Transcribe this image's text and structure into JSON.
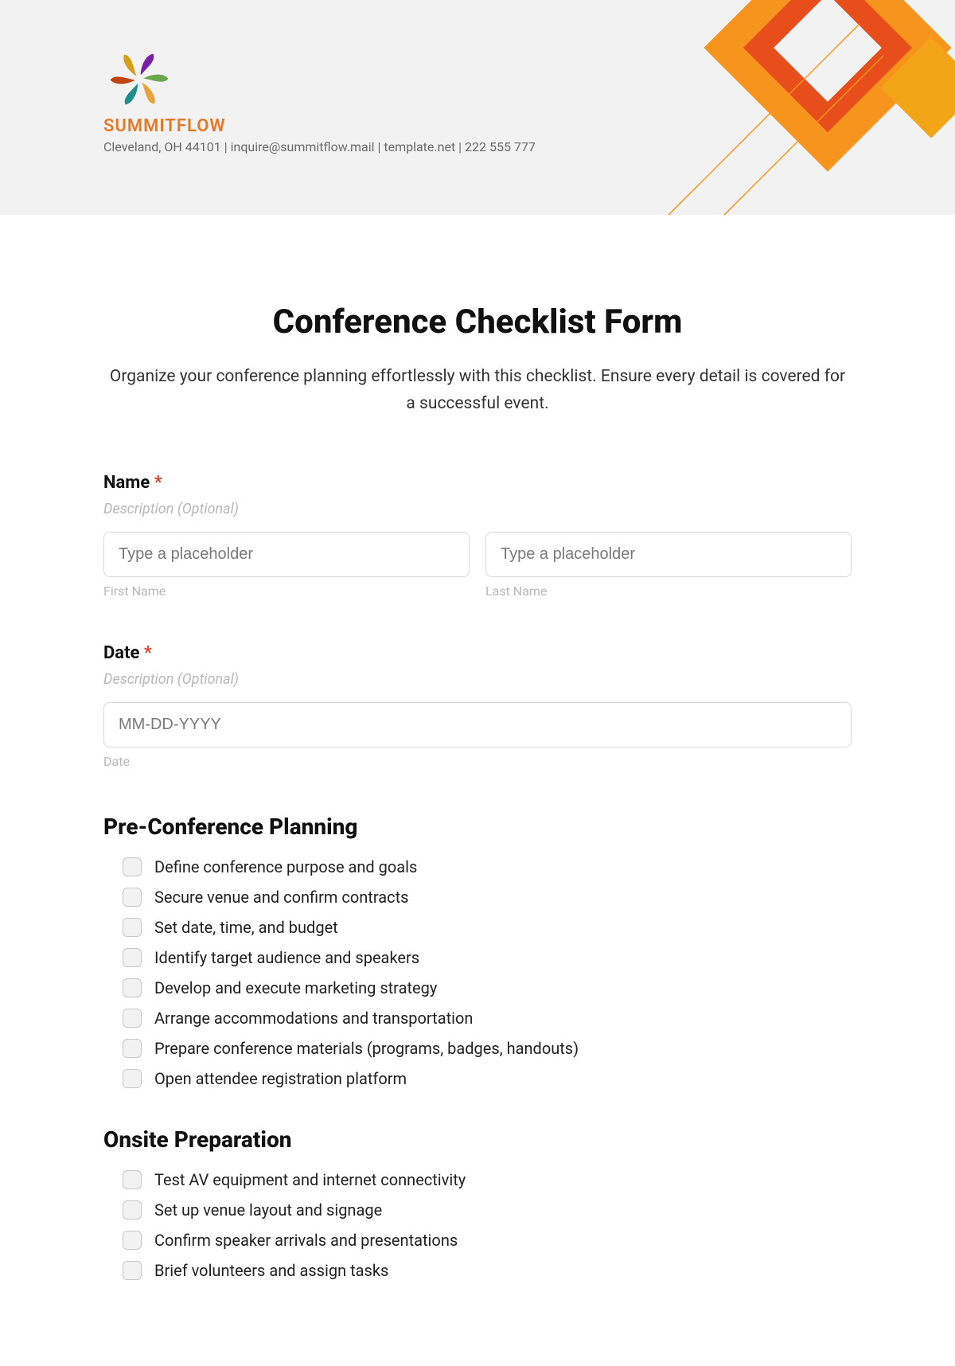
{
  "header": {
    "brand_name": "SUMMITFLOW",
    "brand_info": "Cleveland, OH 44101 | inquire@summitflow.mail | template.net | 222 555 777"
  },
  "page": {
    "title": "Conference Checklist Form",
    "intro": "Organize your conference planning effortlessly with this checklist. Ensure every detail is covered for a successful event."
  },
  "fields": {
    "name": {
      "label": "Name",
      "required_mark": "*",
      "description": "Description (Optional)",
      "first_placeholder": "Type a placeholder",
      "first_sublabel": "First Name",
      "last_placeholder": "Type a placeholder",
      "last_sublabel": "Last Name"
    },
    "date": {
      "label": "Date",
      "required_mark": "*",
      "description": "Description (Optional)",
      "placeholder": "MM-DD-YYYY",
      "sublabel": "Date"
    }
  },
  "sections": [
    {
      "title": "Pre-Conference Planning",
      "items": [
        "Define conference purpose and goals",
        "Secure venue and confirm contracts",
        "Set date, time, and budget",
        "Identify target audience and speakers",
        "Develop and execute marketing strategy",
        "Arrange accommodations and transportation",
        "Prepare conference materials (programs, badges, handouts)",
        "Open attendee registration platform"
      ]
    },
    {
      "title": "Onsite Preparation",
      "items": [
        "Test AV equipment and internet connectivity",
        "Set up venue layout and signage",
        "Confirm speaker arrivals and presentations",
        "Brief volunteers and assign tasks"
      ]
    }
  ]
}
